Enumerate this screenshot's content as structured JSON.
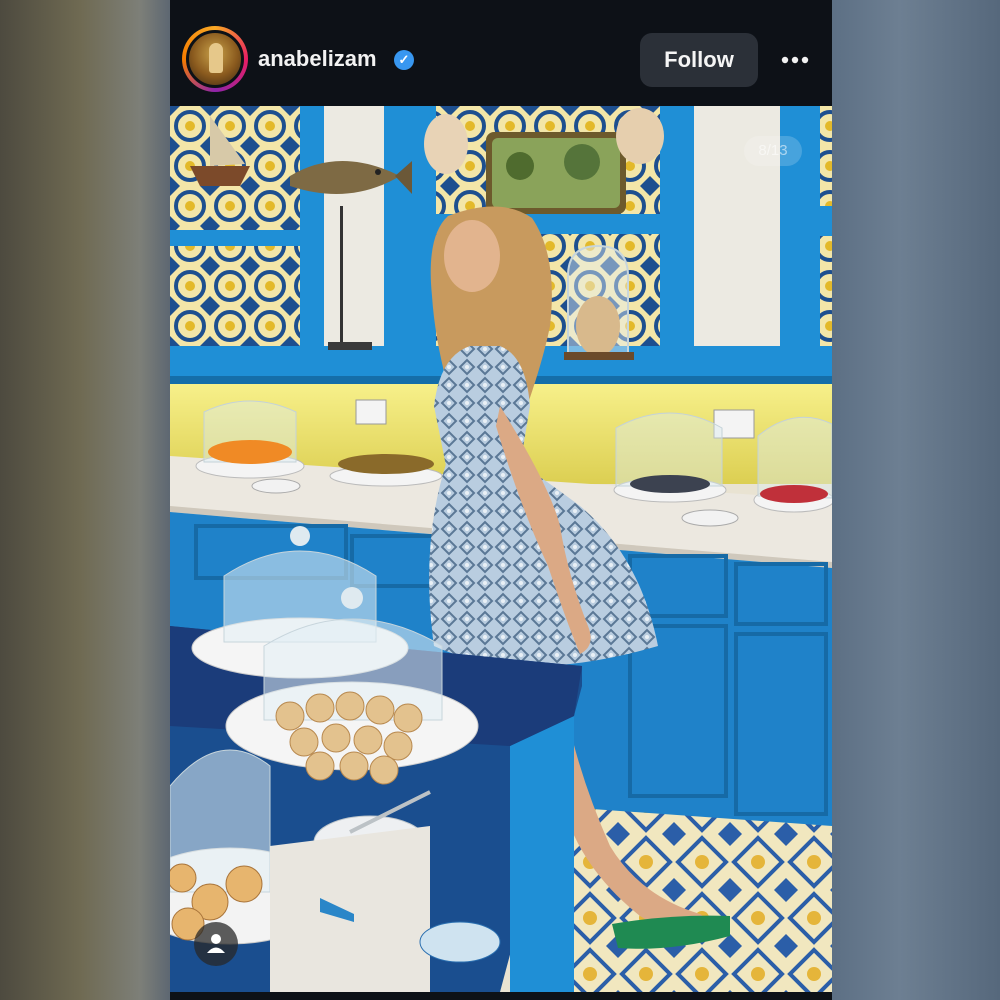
{
  "post": {
    "username": "anabelizam",
    "verified_mark": "✓",
    "follow_label": "Follow",
    "more_icon": "more-horizontal-icon",
    "counter": "8/13",
    "tag_icon": "user-tag-icon"
  },
  "colors": {
    "background": "#0d1117",
    "follow_button": "#2b3038",
    "verified": "#3897f0",
    "cabinet_blue": "#1f8fd6"
  },
  "photo": {
    "description_icon": "photo-content"
  }
}
